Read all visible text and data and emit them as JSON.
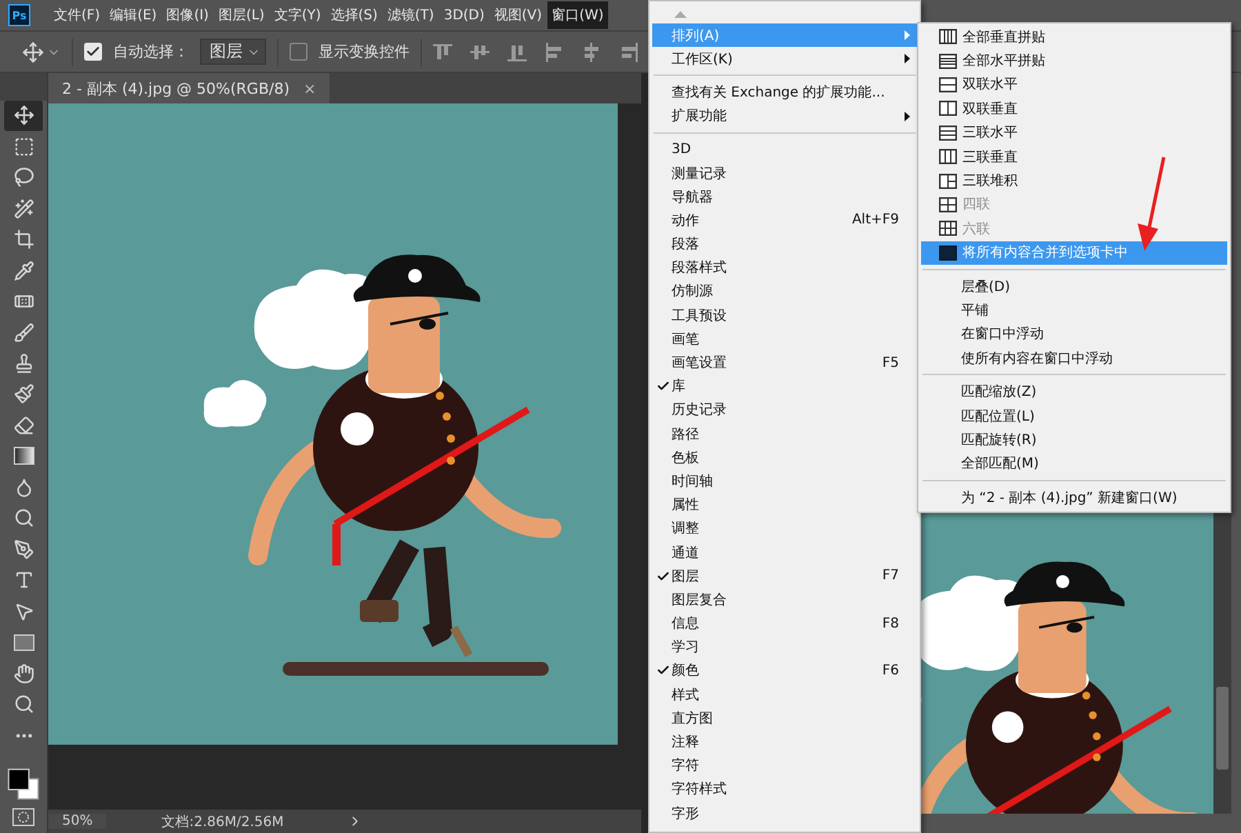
{
  "app": {
    "logo": "Ps"
  },
  "menu_bar": [
    {
      "label": "文件(F)",
      "selected": false
    },
    {
      "label": "编辑(E)",
      "selected": false
    },
    {
      "label": "图像(I)",
      "selected": false
    },
    {
      "label": "图层(L)",
      "selected": false
    },
    {
      "label": "文字(Y)",
      "selected": false
    },
    {
      "label": "选择(S)",
      "selected": false
    },
    {
      "label": "滤镜(T)",
      "selected": false
    },
    {
      "label": "3D(D)",
      "selected": false
    },
    {
      "label": "视图(V)",
      "selected": false
    },
    {
      "label": "窗口(W)",
      "selected": true
    }
  ],
  "options_bar": {
    "auto_select": {
      "label": "自动选择：",
      "checked": true
    },
    "target_dropdown": {
      "value": "图层"
    },
    "show_transform_controls": {
      "label": "显示变换控件",
      "checked": false
    }
  },
  "document_tab": {
    "title": "2 - 副本 (4).jpg @ 50%(RGB/8)",
    "close": "×"
  },
  "window_menu": {
    "items": [
      {
        "kind": "scroll"
      },
      {
        "kind": "item",
        "label": "排列(A)",
        "submenu": true,
        "checked": false,
        "selected": true
      },
      {
        "kind": "item",
        "label": "工作区(K)",
        "submenu": true,
        "checked": false,
        "selected": false
      },
      {
        "kind": "separator"
      },
      {
        "kind": "item",
        "label": "查找有关 Exchange 的扩展功能...",
        "submenu": false,
        "checked": false,
        "selected": false
      },
      {
        "kind": "item",
        "label": "扩展功能",
        "submenu": true,
        "checked": false,
        "selected": false
      },
      {
        "kind": "separator"
      },
      {
        "kind": "item",
        "label": "3D",
        "submenu": false,
        "checked": false,
        "selected": false
      },
      {
        "kind": "item",
        "label": "测量记录",
        "submenu": false,
        "checked": false,
        "selected": false
      },
      {
        "kind": "item",
        "label": "导航器",
        "submenu": false,
        "checked": false,
        "selected": false
      },
      {
        "kind": "item",
        "label": "动作",
        "shortcut": "Alt+F9",
        "submenu": false,
        "checked": false,
        "selected": false
      },
      {
        "kind": "item",
        "label": "段落",
        "submenu": false,
        "checked": false,
        "selected": false
      },
      {
        "kind": "item",
        "label": "段落样式",
        "submenu": false,
        "checked": false,
        "selected": false
      },
      {
        "kind": "item",
        "label": "仿制源",
        "submenu": false,
        "checked": false,
        "selected": false
      },
      {
        "kind": "item",
        "label": "工具预设",
        "submenu": false,
        "checked": false,
        "selected": false
      },
      {
        "kind": "item",
        "label": "画笔",
        "submenu": false,
        "checked": false,
        "selected": false
      },
      {
        "kind": "item",
        "label": "画笔设置",
        "shortcut": "F5",
        "submenu": false,
        "checked": false,
        "selected": false
      },
      {
        "kind": "item",
        "label": "库",
        "submenu": false,
        "checked": true,
        "selected": false
      },
      {
        "kind": "item",
        "label": "历史记录",
        "submenu": false,
        "checked": false,
        "selected": false
      },
      {
        "kind": "item",
        "label": "路径",
        "submenu": false,
        "checked": false,
        "selected": false
      },
      {
        "kind": "item",
        "label": "色板",
        "submenu": false,
        "checked": false,
        "selected": false
      },
      {
        "kind": "item",
        "label": "时间轴",
        "submenu": false,
        "checked": false,
        "selected": false
      },
      {
        "kind": "item",
        "label": "属性",
        "submenu": false,
        "checked": false,
        "selected": false
      },
      {
        "kind": "item",
        "label": "调整",
        "submenu": false,
        "checked": false,
        "selected": false
      },
      {
        "kind": "item",
        "label": "通道",
        "submenu": false,
        "checked": false,
        "selected": false
      },
      {
        "kind": "item",
        "label": "图层",
        "shortcut": "F7",
        "submenu": false,
        "checked": true,
        "selected": false
      },
      {
        "kind": "item",
        "label": "图层复合",
        "submenu": false,
        "checked": false,
        "selected": false
      },
      {
        "kind": "item",
        "label": "信息",
        "shortcut": "F8",
        "submenu": false,
        "checked": false,
        "selected": false
      },
      {
        "kind": "item",
        "label": "学习",
        "submenu": false,
        "checked": false,
        "selected": false
      },
      {
        "kind": "item",
        "label": "颜色",
        "shortcut": "F6",
        "submenu": false,
        "checked": true,
        "selected": false
      },
      {
        "kind": "item",
        "label": "样式",
        "submenu": false,
        "checked": false,
        "selected": false
      },
      {
        "kind": "item",
        "label": "直方图",
        "submenu": false,
        "checked": false,
        "selected": false
      },
      {
        "kind": "item",
        "label": "注释",
        "submenu": false,
        "checked": false,
        "selected": false
      },
      {
        "kind": "item",
        "label": "字符",
        "submenu": false,
        "checked": false,
        "selected": false
      },
      {
        "kind": "item",
        "label": "字符样式",
        "submenu": false,
        "checked": false,
        "selected": false
      },
      {
        "kind": "item",
        "label": "字形",
        "submenu": false,
        "checked": false,
        "selected": false
      }
    ]
  },
  "arrange_submenu": {
    "items": [
      {
        "kind": "layout",
        "label": "全部垂直拼贴",
        "disabled": false,
        "selected": false
      },
      {
        "kind": "layout",
        "label": "全部水平拼贴",
        "disabled": false,
        "selected": false
      },
      {
        "kind": "layout",
        "label": "双联水平",
        "disabled": false,
        "selected": false
      },
      {
        "kind": "layout",
        "label": "双联垂直",
        "disabled": false,
        "selected": false
      },
      {
        "kind": "layout",
        "label": "三联水平",
        "disabled": false,
        "selected": false
      },
      {
        "kind": "layout",
        "label": "三联垂直",
        "disabled": false,
        "selected": false
      },
      {
        "kind": "layout",
        "label": "三联堆积",
        "disabled": false,
        "selected": false
      },
      {
        "kind": "layout",
        "label": "四联",
        "disabled": true,
        "selected": false
      },
      {
        "kind": "layout",
        "label": "六联",
        "disabled": true,
        "selected": false
      },
      {
        "kind": "layout",
        "label": "将所有内容合并到选项卡中",
        "disabled": false,
        "selected": true
      },
      {
        "kind": "separator"
      },
      {
        "kind": "plain",
        "label": "层叠(D)",
        "disabled": false,
        "selected": false
      },
      {
        "kind": "plain",
        "label": "平铺",
        "disabled": false,
        "selected": false
      },
      {
        "kind": "plain",
        "label": "在窗口中浮动",
        "disabled": false,
        "selected": false
      },
      {
        "kind": "plain",
        "label": "使所有内容在窗口中浮动",
        "disabled": false,
        "selected": false
      },
      {
        "kind": "separator"
      },
      {
        "kind": "plain",
        "label": "匹配缩放(Z)",
        "disabled": false,
        "selected": false
      },
      {
        "kind": "plain",
        "label": "匹配位置(L)",
        "disabled": false,
        "selected": false
      },
      {
        "kind": "plain",
        "label": "匹配旋转(R)",
        "disabled": false,
        "selected": false
      },
      {
        "kind": "plain",
        "label": "全部匹配(M)",
        "disabled": false,
        "selected": false
      },
      {
        "kind": "separator"
      },
      {
        "kind": "plain",
        "label": "为 “2 - 副本 (4).jpg” 新建窗口(W)",
        "disabled": false,
        "selected": false
      }
    ]
  },
  "status_bar": {
    "zoom": "50%",
    "document": "文档:2.86M/2.56M"
  }
}
